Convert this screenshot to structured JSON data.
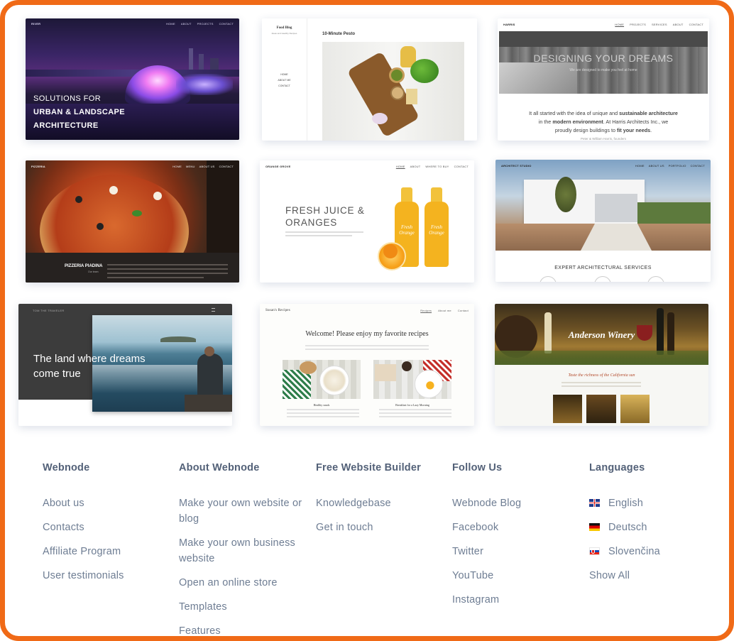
{
  "templates": {
    "t1": {
      "brand": "RIVER",
      "nav": [
        "HOME",
        "ABOUT",
        "PROJECTS",
        "CONTACT"
      ],
      "line1": "SOLUTIONS FOR",
      "line2": "URBAN & LANDSCAPE",
      "line3": "ARCHITECTURE"
    },
    "t2": {
      "brand": "Food Blog",
      "tagline": "Ideas and Healthy Recipes",
      "nav": [
        "HOME",
        "ABOUT ME",
        "CONTACT"
      ],
      "post_title": "10-Minute Pesto"
    },
    "t3": {
      "brand": "HARRIS",
      "nav": [
        "HOME",
        "PROJECTS",
        "SERVICES",
        "ABOUT",
        "CONTACT"
      ],
      "hero": "DESIGNING YOUR DREAMS",
      "hero_sub": "We are designed to make you feel at home",
      "p1": "It all started with the idea of unique and ",
      "p1b": "sustainable architecture",
      "p2": "in the ",
      "p2b": "modern environment",
      "p2c": ". At Harris Architects Inc., we",
      "p3": "proudly design buildings to ",
      "p3b": "fit your needs",
      "p3c": ".",
      "sign": "Peter & William Harris, founders"
    },
    "t4": {
      "brand": "PIZZERIA",
      "nav": [
        "HOME",
        "MENU",
        "ABOUT US",
        "CONTACT"
      ],
      "title": "PIZZERIA PIADINA",
      "subtitle": "Our team"
    },
    "t5": {
      "brand": "ORANGE GROVE",
      "nav": [
        "HOME",
        "ABOUT",
        "WHERE TO BUY",
        "CONTACT"
      ],
      "h1": "FRESH JUICE &",
      "h2": "ORANGES",
      "bottle_label": "Fresh Orange"
    },
    "t6": {
      "brand": "ARCHITECT STUDIO",
      "nav": [
        "HOME",
        "ABOUT US",
        "PORTFOLIO",
        "CONTACT"
      ],
      "services": "EXPERT ARCHITECTURAL SERVICES"
    },
    "t7": {
      "brand": "TOM THE TRAVELER",
      "line1": "The land where dreams",
      "line2": "come true"
    },
    "t8": {
      "brand": "Susan's Recipes",
      "nav": [
        "Recipes",
        "About me",
        "Contact"
      ],
      "welcome": "Welcome! Please enjoy my favorite recipes",
      "card1": "Healthy snack",
      "card2": "Breakfast for a Lazy Morning"
    },
    "t9": {
      "brand": "Anderson Winery",
      "tagline": "Taste the richness of the California sun"
    }
  },
  "footer": {
    "columns": [
      {
        "title": "Webnode",
        "links": [
          "About us",
          "Contacts",
          "Affiliate Program",
          "User testimonials"
        ]
      },
      {
        "title": "About Webnode",
        "links": [
          "Make your own website or blog",
          "Make your own business website",
          "Open an online store",
          "Templates",
          "Features"
        ]
      },
      {
        "title": "Free Website Builder",
        "links": [
          "Knowledgebase",
          "Get in touch"
        ]
      },
      {
        "title": "Follow Us",
        "links": [
          "Webnode Blog",
          "Facebook",
          "Twitter",
          "YouTube",
          "Instagram"
        ]
      }
    ],
    "languages": {
      "title": "Languages",
      "items": [
        {
          "label": "English",
          "icon": "uk-flag-icon"
        },
        {
          "label": "Deutsch",
          "icon": "germany-flag-icon"
        },
        {
          "label": "Slovenčina",
          "icon": "slovakia-flag-icon"
        }
      ],
      "show_all": "Show All"
    }
  },
  "colors": {
    "frame": "#f06a17",
    "heading": "#536178",
    "link": "#6e7d93"
  }
}
